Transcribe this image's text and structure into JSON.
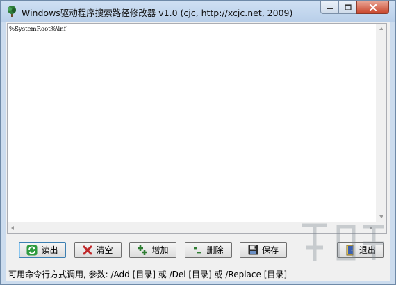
{
  "window": {
    "title": "Windows驱动程序搜索路径修改器 v1.0 (cjc, http://xcjc.net, 2009)"
  },
  "editor": {
    "content": "%SystemRoot%\\inf"
  },
  "toolbar": {
    "read_label": "读出",
    "clear_label": "清空",
    "add_label": "增加",
    "delete_label": "删除",
    "save_label": "保存",
    "exit_label": "退出"
  },
  "statusbar": {
    "text": "可用命令行方式调用, 参数: /Add [目录] 或 /Del [目录] 或 /Replace [目录]"
  },
  "colors": {
    "title_bg": "#c3d7ef",
    "close_button": "#c9452b",
    "focus_border": "#3c7fb1"
  },
  "icons": {
    "app": "tree-icon",
    "read": "refresh-icon",
    "clear": "x-icon",
    "add": "plus-icon",
    "delete": "minus-icon",
    "save": "floppy-disk-icon",
    "exit": "door-exit-icon"
  }
}
